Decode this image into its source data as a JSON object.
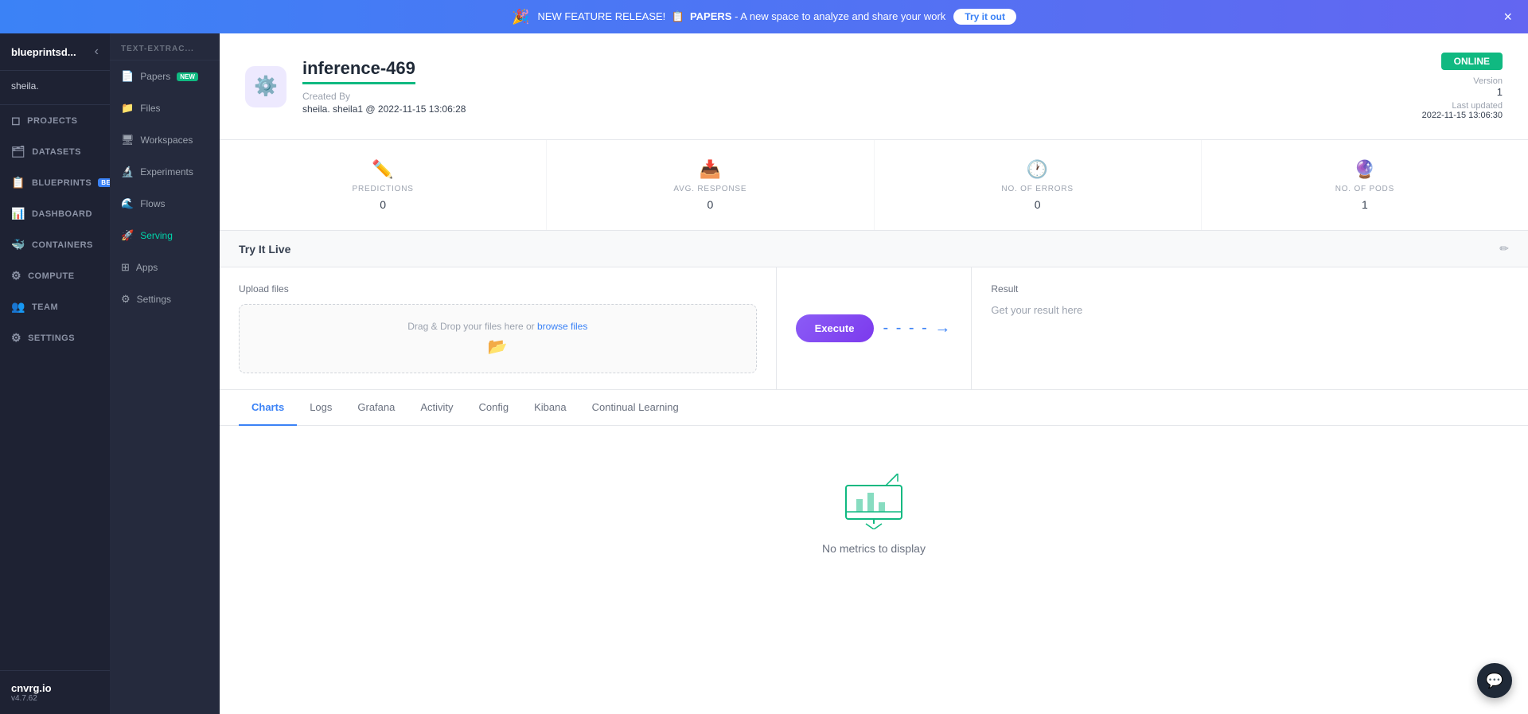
{
  "banner": {
    "icon": "🎉",
    "pre_text": "NEW FEATURE RELEASE!",
    "papers_label": "PAPERS",
    "post_text": " - A new space to analyze and share your work",
    "try_label": "Try it out",
    "close": "×"
  },
  "sidebar_left": {
    "brand": "blueprintsd...",
    "user": "sheila.",
    "nav_items": [
      {
        "id": "projects",
        "label": "PROJECTS",
        "icon": "◻"
      },
      {
        "id": "datasets",
        "label": "DATASETS",
        "icon": "🗂"
      },
      {
        "id": "blueprints",
        "label": "BLUEPRINTS",
        "icon": "📋",
        "badge": "BETA"
      },
      {
        "id": "dashboard",
        "label": "DASHBOARD",
        "icon": "📊"
      },
      {
        "id": "containers",
        "label": "CONTAINERS",
        "icon": "🐳"
      },
      {
        "id": "compute",
        "label": "COMPUTE",
        "icon": "⚙"
      },
      {
        "id": "team",
        "label": "TEAM",
        "icon": "👥"
      },
      {
        "id": "settings",
        "label": "SETTINGS",
        "icon": "⚙"
      }
    ],
    "footer_brand": "cnvrg.io",
    "footer_version": "v4.7.62"
  },
  "sidebar_second": {
    "sections": [
      {
        "header": "text-extrac...",
        "items": [
          {
            "id": "papers",
            "label": "Papers",
            "icon": "📄",
            "badge": "NEW"
          },
          {
            "id": "files",
            "label": "Files",
            "icon": "📁"
          },
          {
            "id": "workspaces",
            "label": "Workspaces",
            "icon": "🖥"
          },
          {
            "id": "experiments",
            "label": "Experiments",
            "icon": "🔬"
          },
          {
            "id": "flows",
            "label": "Flows",
            "icon": "🌊"
          },
          {
            "id": "serving",
            "label": "Serving",
            "icon": "🚀",
            "active": true
          },
          {
            "id": "apps",
            "label": "Apps",
            "icon": "⊞"
          },
          {
            "id": "settings",
            "label": "Settings",
            "icon": "⚙"
          }
        ]
      }
    ]
  },
  "model": {
    "name": "inference-469",
    "icon": "⚙",
    "created_by_label": "Created By",
    "created_by_value": "sheila. sheila1 @ 2022-11-15 13:06:28",
    "version_label": "Version",
    "version_value": "1",
    "status": "ONLINE",
    "last_updated_label": "Last updated",
    "last_updated_value": "2022-11-15 13:06:30"
  },
  "stats": [
    {
      "id": "predictions",
      "label": "PREDICTIONS",
      "value": "0",
      "icon": "✏️"
    },
    {
      "id": "avg_response",
      "label": "AVG. RESPONSE",
      "value": "0",
      "icon": "📥"
    },
    {
      "id": "no_errors",
      "label": "NO. OF ERRORS",
      "value": "0",
      "icon": "🕐"
    },
    {
      "id": "no_pods",
      "label": "NO. OF PODS",
      "value": "1",
      "icon": "🔮"
    }
  ],
  "try_live": {
    "title": "Try It Live",
    "upload_label": "Upload files",
    "drag_text": "Drag & Drop your files here or ",
    "browse_text": "browse files",
    "execute_label": "Execute",
    "result_label": "Result",
    "result_placeholder": "Get your result here"
  },
  "tabs": [
    {
      "id": "charts",
      "label": "Charts",
      "active": true
    },
    {
      "id": "logs",
      "label": "Logs"
    },
    {
      "id": "grafana",
      "label": "Grafana"
    },
    {
      "id": "activity",
      "label": "Activity"
    },
    {
      "id": "config",
      "label": "Config"
    },
    {
      "id": "kibana",
      "label": "Kibana"
    },
    {
      "id": "continual_learning",
      "label": "Continual Learning"
    }
  ],
  "no_metrics": "No metrics to display"
}
